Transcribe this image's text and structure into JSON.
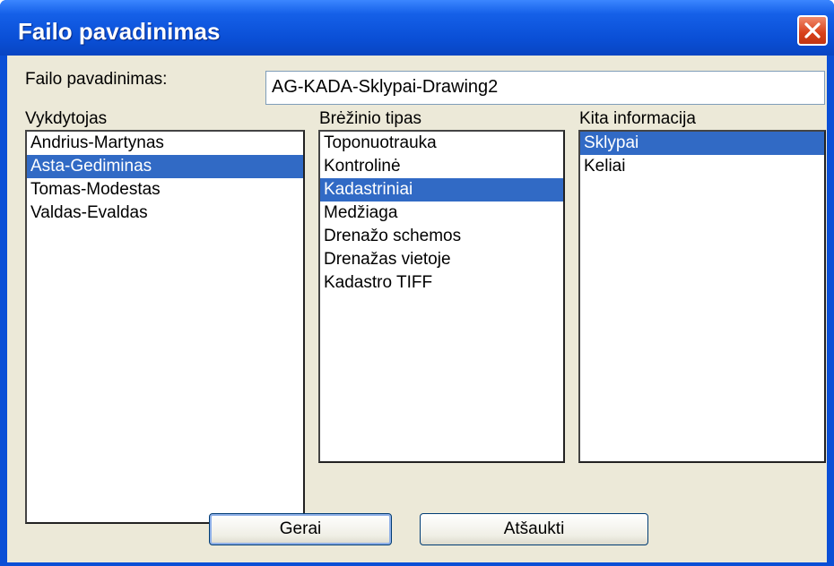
{
  "window": {
    "title": "Failo pavadinimas"
  },
  "filename": {
    "label": "Failo pavadinimas:",
    "value": "AG-KADA-Sklypai-Drawing2"
  },
  "lists": {
    "executor": {
      "label": "Vykdytojas",
      "items": [
        "Andrius-Martynas",
        "Asta-Gediminas",
        "Tomas-Modestas",
        "Valdas-Evaldas"
      ],
      "selected": "Asta-Gediminas"
    },
    "drawing_type": {
      "label": "Brėžinio tipas",
      "items": [
        "Toponuotrauka",
        "Kontrolinė",
        "Kadastriniai",
        "Medžiaga",
        "Drenažo schemos",
        "Drenažas vietoje",
        "Kadastro TIFF"
      ],
      "selected": "Kadastriniai"
    },
    "other_info": {
      "label": "Kita informacija",
      "items": [
        "Sklypai",
        "Keliai"
      ],
      "selected": "Sklypai"
    }
  },
  "buttons": {
    "ok": "Gerai",
    "cancel": "Atšaukti"
  },
  "colors": {
    "titlebar": "#0a4fd6",
    "selection": "#316ac5",
    "client": "#ece9d8",
    "close": "#d8401a"
  }
}
